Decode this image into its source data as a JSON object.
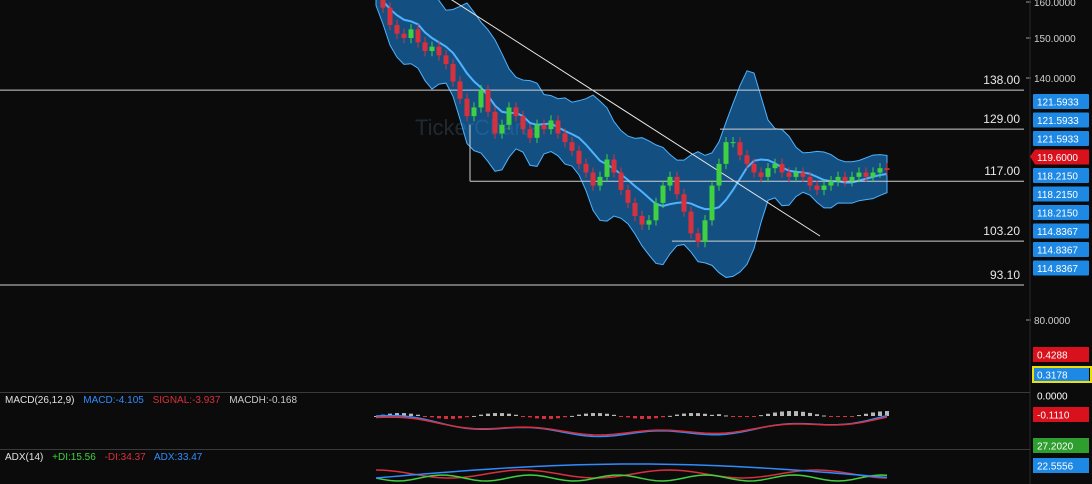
{
  "colors": {
    "background": "#0b0b0b",
    "up_candle": "#3fd13f",
    "down_candle": "#d8303c",
    "band_fill": "#1e88e5",
    "band_edge": "#4db3ff",
    "macd_line": "#2f8cff",
    "signal_line": "#d8303c",
    "adx_line": "#2f8cff",
    "plus_di": "#3fd13f",
    "minus_di": "#d8303c",
    "tag_blue": "#1e88e5",
    "tag_red": "#d8111c",
    "tag_green": "#2e9e2e"
  },
  "watermark": "TickerCharts",
  "price_axis": {
    "ticks": [
      "160.0000",
      "150.0000",
      "140.0000",
      "80.0000"
    ]
  },
  "horizontal_lines": [
    {
      "label": "138.00",
      "price": 138.0
    },
    {
      "label": "129.00",
      "price": 129.0
    },
    {
      "label": "117.00",
      "price": 117.0
    },
    {
      "label": "103.20",
      "price": 103.2
    },
    {
      "label": "93.10",
      "price": 93.1
    }
  ],
  "price_tags": [
    {
      "text": "121.5933",
      "color": "blue"
    },
    {
      "text": "121.5933",
      "color": "blue"
    },
    {
      "text": "121.5933",
      "color": "blue"
    },
    {
      "text": "119.6000",
      "color": "red"
    },
    {
      "text": "118.2150",
      "color": "blue"
    },
    {
      "text": "118.2150",
      "color": "blue"
    },
    {
      "text": "118.2150",
      "color": "blue"
    },
    {
      "text": "114.8367",
      "color": "blue"
    },
    {
      "text": "114.8367",
      "color": "blue"
    },
    {
      "text": "114.8367",
      "color": "blue"
    }
  ],
  "macd_legend": {
    "name": "MACD(26,12,9)",
    "macd": "MACD:-4.105",
    "signal": "SIGNAL:-3.937",
    "hist": "MACDH:-0.168"
  },
  "macd_tags": [
    {
      "text": "0.4288",
      "color": "red"
    },
    {
      "text": "0.3178",
      "color": "blue"
    },
    {
      "text": "0.0000",
      "color": "none"
    },
    {
      "text": "-0.1110",
      "color": "red"
    }
  ],
  "adx_legend": {
    "name": "ADX(14)",
    "plus_di": "+DI:15.56",
    "minus_di": "-DI:34.37",
    "adx": "ADX:33.47"
  },
  "adx_tags": [
    {
      "text": "27.2020",
      "color": "green"
    },
    {
      "text": "22.5556",
      "color": "blue"
    }
  ],
  "chart_data": {
    "type": "candlestick",
    "title": "",
    "ylim": [
      76,
      160
    ],
    "closes": [
      160,
      157,
      153,
      151,
      150,
      152,
      149,
      147,
      148,
      146,
      144,
      140,
      136,
      132,
      134,
      138,
      133,
      128,
      130,
      134,
      132,
      129,
      127,
      130,
      129,
      131,
      128,
      126,
      124,
      121,
      119,
      116,
      118,
      122,
      119,
      115,
      112,
      109,
      107,
      108,
      112,
      116,
      118,
      114,
      110,
      105,
      103,
      108,
      116,
      121,
      126,
      126,
      123,
      121,
      119,
      118,
      120,
      121,
      119,
      118,
      119,
      118,
      116,
      115,
      116,
      117,
      118,
      117,
      118,
      119,
      118,
      119,
      120,
      119.6
    ],
    "bollinger": {
      "upper_max": 160,
      "lower_min": 103,
      "middle_last": 118.2
    },
    "trendline": {
      "start_price": 162,
      "end_price": 102
    },
    "support_resistance": [
      138.0,
      129.0,
      117.0,
      103.2,
      93.1
    ]
  }
}
